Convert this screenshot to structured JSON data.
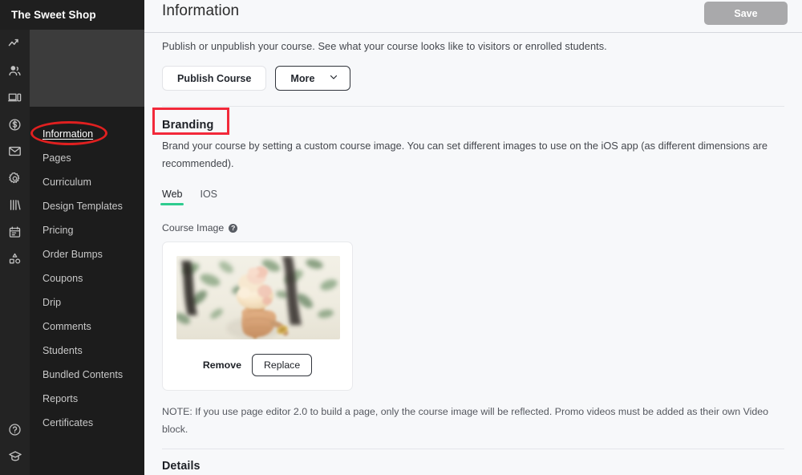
{
  "brand": {
    "title": "The Sweet Shop"
  },
  "icon_rail": {
    "top_icons": [
      {
        "name": "analytics-icon"
      },
      {
        "name": "audience-icon"
      },
      {
        "name": "site-icon"
      },
      {
        "name": "sales-icon"
      },
      {
        "name": "email-icon"
      },
      {
        "name": "settings-icon"
      },
      {
        "name": "library-icon"
      },
      {
        "name": "calendar-icon"
      },
      {
        "name": "apps-icon"
      }
    ],
    "bottom_icons": [
      {
        "name": "help-icon"
      },
      {
        "name": "graduation-icon"
      }
    ]
  },
  "sidebar": {
    "items": [
      {
        "label": "Information",
        "active": true
      },
      {
        "label": "Pages",
        "active": false
      },
      {
        "label": "Curriculum",
        "active": false
      },
      {
        "label": "Design Templates",
        "active": false
      },
      {
        "label": "Pricing",
        "active": false
      },
      {
        "label": "Order Bumps",
        "active": false
      },
      {
        "label": "Coupons",
        "active": false
      },
      {
        "label": "Drip",
        "active": false
      },
      {
        "label": "Comments",
        "active": false
      },
      {
        "label": "Students",
        "active": false
      },
      {
        "label": "Bundled Contents",
        "active": false
      },
      {
        "label": "Reports",
        "active": false
      },
      {
        "label": "Certificates",
        "active": false
      }
    ]
  },
  "header": {
    "title": "Information",
    "save_label": "Save"
  },
  "publish": {
    "description": "Publish or unpublish your course. See what your course looks like to visitors or enrolled students.",
    "publish_label": "Publish Course",
    "more_label": "More"
  },
  "branding": {
    "heading": "Branding",
    "description": "Brand your course by setting a custom course image. You can set different images to use on the iOS app (as different dimensions are recommended).",
    "tabs": [
      {
        "label": "Web",
        "active": true
      },
      {
        "label": "IOS",
        "active": false
      }
    ],
    "course_image_label": "Course Image",
    "help_glyph": "?",
    "remove_label": "Remove",
    "replace_label": "Replace",
    "note": "NOTE: If you use page editor 2.0 to build a page, only the course image will be reflected. Promo videos must be added as their own Video block."
  },
  "details": {
    "heading": "Details"
  },
  "colors": {
    "accent_green": "#2ecc8f",
    "annotation_red": "#f2293a",
    "save_grey": "#a9a9ab",
    "sidebar_dark": "#1c1c1c",
    "rail_dark": "#232323",
    "content_bg": "#f7f8fa"
  }
}
